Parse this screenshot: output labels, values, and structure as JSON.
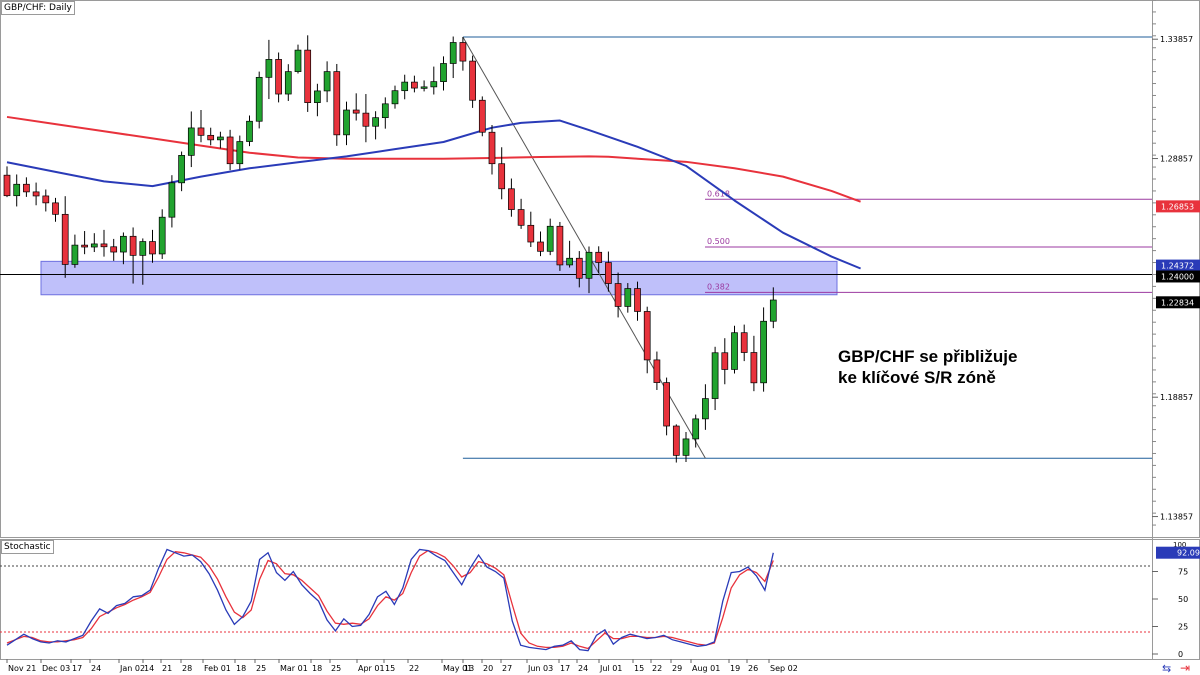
{
  "chart_data": {
    "type": "candlestick",
    "title": "GBP/CHF: Daily",
    "annotation": [
      "GBP/CHF se přibližuje",
      "ke klíčové S/R zóně"
    ],
    "y_ticks": [
      1.33857,
      1.28857,
      1.18857,
      1.13857
    ],
    "ylim": [
      1.13,
      1.355
    ],
    "x_tick_labels": [
      "Nov 21",
      "Dec 03",
      "17",
      "24",
      "Jan 02",
      "14",
      "21",
      "28",
      "Feb 01",
      "18",
      "25",
      "Mar 01",
      "18",
      "25",
      "Apr 01",
      "15",
      "22",
      "May 01",
      "13",
      "20",
      "27",
      "Jun 03",
      "17",
      "24",
      "Jul 01",
      "15",
      "22",
      "29",
      "Aug 01",
      "19",
      "26",
      "Sep 02"
    ],
    "price_badges": [
      {
        "value": "1.26853",
        "color": "#e8323c"
      },
      {
        "value": "1.24372",
        "color": "#2a3bb8"
      },
      {
        "value": "1.24000",
        "color": "#000000"
      },
      {
        "value": "1.22834",
        "color": "#000000"
      }
    ],
    "fib_levels": [
      {
        "label": "0.618",
        "value": 1.2715
      },
      {
        "label": "0.500",
        "value": 1.2515
      },
      {
        "label": "0.382",
        "value": 1.2325
      }
    ],
    "fib_range": {
      "high": 1.3395,
      "low": 1.163
    },
    "sr_zone": [
      1.2315,
      1.2455
    ],
    "horizontal_line": 1.24,
    "series": [
      {
        "name": "",
        "color": "#e8323c",
        "points": [
          [
            0,
            1.306
          ],
          [
            5,
            1.303
          ],
          [
            10,
            1.3
          ],
          [
            15,
            1.297
          ],
          [
            20,
            1.294
          ],
          [
            25,
            1.291
          ],
          [
            30,
            1.289
          ],
          [
            35,
            1.2885
          ],
          [
            40,
            1.2885
          ],
          [
            45,
            1.2885
          ],
          [
            50,
            1.2888
          ],
          [
            55,
            1.2892
          ],
          [
            60,
            1.2895
          ],
          [
            62,
            1.2893
          ],
          [
            65,
            1.2885
          ],
          [
            70,
            1.2872
          ],
          [
            75,
            1.2845
          ],
          [
            80,
            1.281
          ],
          [
            85,
            1.275
          ],
          [
            88,
            1.2705
          ]
        ]
      },
      {
        "name": "",
        "color": "#2a3bb8",
        "points": [
          [
            0,
            1.287
          ],
          [
            5,
            1.283
          ],
          [
            10,
            1.279
          ],
          [
            15,
            1.277
          ],
          [
            20,
            1.281
          ],
          [
            25,
            1.2845
          ],
          [
            30,
            1.287
          ],
          [
            35,
            1.2895
          ],
          [
            40,
            1.2925
          ],
          [
            45,
            1.2955
          ],
          [
            50,
            1.3015
          ],
          [
            53,
            1.3035
          ],
          [
            57,
            1.3045
          ],
          [
            60,
            1.3005
          ],
          [
            65,
            1.2935
          ],
          [
            70,
            1.2855
          ],
          [
            75,
            1.271
          ],
          [
            80,
            1.2575
          ],
          [
            85,
            1.2475
          ],
          [
            88,
            1.2425
          ]
        ]
      }
    ],
    "candles": [
      [
        1.2816,
        1.2853,
        1.2724,
        1.273
      ],
      [
        1.273,
        1.2819,
        1.2685,
        1.2778
      ],
      [
        1.2778,
        1.2807,
        1.2725,
        1.2746
      ],
      [
        1.2746,
        1.2785,
        1.269,
        1.2729
      ],
      [
        1.2729,
        1.2756,
        1.2664,
        1.27
      ],
      [
        1.27,
        1.2721,
        1.2621,
        1.2652
      ],
      [
        1.2652,
        1.2728,
        1.2386,
        1.2442
      ],
      [
        1.2442,
        1.2567,
        1.2428,
        1.2523
      ],
      [
        1.2523,
        1.2582,
        1.2485,
        1.2515
      ],
      [
        1.2515,
        1.2573,
        1.2494,
        1.2528
      ],
      [
        1.2528,
        1.2587,
        1.2475,
        1.2516
      ],
      [
        1.2516,
        1.2549,
        1.2457,
        1.2494
      ],
      [
        1.2494,
        1.2576,
        1.2443,
        1.256
      ],
      [
        1.256,
        1.2597,
        1.2362,
        1.248
      ],
      [
        1.248,
        1.2551,
        1.2357,
        1.2538
      ],
      [
        1.2538,
        1.2587,
        1.2449,
        1.2486
      ],
      [
        1.2486,
        1.2673,
        1.2465,
        1.264
      ],
      [
        1.264,
        1.2816,
        1.2597,
        1.2784
      ],
      [
        1.2784,
        1.2915,
        1.2749,
        1.2899
      ],
      [
        1.2899,
        1.3083,
        1.285,
        1.3014
      ],
      [
        1.3014,
        1.3089,
        1.2954,
        1.2983
      ],
      [
        1.2983,
        1.3015,
        1.2941,
        1.2964
      ],
      [
        1.2964,
        1.2998,
        1.2928,
        1.2976
      ],
      [
        1.2976,
        1.3006,
        1.2837,
        1.2864
      ],
      [
        1.2864,
        1.2982,
        1.284,
        1.2957
      ],
      [
        1.2957,
        1.3066,
        1.2938,
        1.3042
      ],
      [
        1.3042,
        1.325,
        1.3012,
        1.3226
      ],
      [
        1.3226,
        1.3383,
        1.3135,
        1.3301
      ],
      [
        1.3301,
        1.333,
        1.3121,
        1.3156
      ],
      [
        1.3156,
        1.3281,
        1.3127,
        1.325
      ],
      [
        1.325,
        1.3363,
        1.3242,
        1.334
      ],
      [
        1.334,
        1.3402,
        1.3081,
        1.312
      ],
      [
        1.312,
        1.3199,
        1.3063,
        1.3169
      ],
      [
        1.3169,
        1.3293,
        1.3122,
        1.325
      ],
      [
        1.325,
        1.3282,
        1.2939,
        1.2985
      ],
      [
        1.2985,
        1.3124,
        1.2942,
        1.3089
      ],
      [
        1.3089,
        1.3159,
        1.3045,
        1.3076
      ],
      [
        1.3076,
        1.3156,
        1.2954,
        1.3021
      ],
      [
        1.3021,
        1.3084,
        1.2966,
        1.3057
      ],
      [
        1.3057,
        1.3142,
        1.3011,
        1.3115
      ],
      [
        1.3115,
        1.3191,
        1.3095,
        1.317
      ],
      [
        1.317,
        1.3237,
        1.3134,
        1.3206
      ],
      [
        1.3206,
        1.3233,
        1.3163,
        1.3181
      ],
      [
        1.3181,
        1.3213,
        1.3167,
        1.3186
      ],
      [
        1.3186,
        1.3271,
        1.3154,
        1.3208
      ],
      [
        1.3208,
        1.3314,
        1.3171,
        1.3284
      ],
      [
        1.3284,
        1.3397,
        1.3223,
        1.3372
      ],
      [
        1.3372,
        1.3395,
        1.3254,
        1.3294
      ],
      [
        1.3294,
        1.3317,
        1.3098,
        1.313
      ],
      [
        1.313,
        1.3146,
        1.2979,
        1.2996
      ],
      [
        1.2996,
        1.3026,
        1.2819,
        1.2864
      ],
      [
        1.2864,
        1.2933,
        1.2715,
        1.2759
      ],
      [
        1.2759,
        1.2802,
        1.2642,
        1.2672
      ],
      [
        1.2672,
        1.2717,
        1.2591,
        1.2606
      ],
      [
        1.2606,
        1.2663,
        1.2515,
        1.2536
      ],
      [
        1.2536,
        1.258,
        1.2477,
        1.2497
      ],
      [
        1.2497,
        1.2634,
        1.2481,
        1.2602
      ],
      [
        1.2602,
        1.262,
        1.2415,
        1.244
      ],
      [
        1.244,
        1.2541,
        1.2429,
        1.2468
      ],
      [
        1.2468,
        1.2498,
        1.2346,
        1.2384
      ],
      [
        1.2384,
        1.2517,
        1.2322,
        1.2493
      ],
      [
        1.2493,
        1.2518,
        1.2406,
        1.245
      ],
      [
        1.245,
        1.2496,
        1.2328,
        1.2362
      ],
      [
        1.2362,
        1.2408,
        1.222,
        1.2266
      ],
      [
        1.2266,
        1.2364,
        1.224,
        1.2341
      ],
      [
        1.2341,
        1.237,
        1.2206,
        1.2245
      ],
      [
        1.2245,
        1.2265,
        1.1986,
        1.2042
      ],
      [
        1.2042,
        1.2077,
        1.1916,
        1.1947
      ],
      [
        1.1947,
        1.1968,
        1.1726,
        1.1765
      ],
      [
        1.1765,
        1.1772,
        1.1612,
        1.1642
      ],
      [
        1.1642,
        1.174,
        1.1614,
        1.1711
      ],
      [
        1.1711,
        1.1813,
        1.1675,
        1.1795
      ],
      [
        1.1795,
        1.194,
        1.1749,
        1.188
      ],
      [
        1.188,
        1.2097,
        1.1832,
        1.2072
      ],
      [
        1.2072,
        1.2133,
        1.194,
        1.2002
      ],
      [
        1.2002,
        1.2185,
        1.1985,
        1.2156
      ],
      [
        1.2156,
        1.219,
        1.2037,
        1.2073
      ],
      [
        1.2073,
        1.2143,
        1.1911,
        1.1946
      ],
      [
        1.1946,
        1.2262,
        1.1909,
        1.2204
      ],
      [
        1.2204,
        1.2346,
        1.2175,
        1.2293
      ]
    ]
  },
  "stochastic": {
    "title": "Stochastic",
    "ylim": [
      0,
      100
    ],
    "y_ticks": [
      75,
      50,
      25,
      0
    ],
    "top_label": "100",
    "levels": [
      80,
      20
    ],
    "value_badge": "92.09",
    "k_line": {
      "name": "",
      "color": "#2a3bb8",
      "values": [
        8,
        13,
        18,
        14,
        11,
        10,
        12,
        11,
        14,
        17,
        30,
        41,
        37,
        44,
        46,
        52,
        53,
        58,
        78,
        95,
        92,
        89,
        90,
        84,
        73,
        58,
        40,
        27,
        34,
        48,
        86,
        92,
        74,
        67,
        75,
        63,
        55,
        48,
        31,
        21,
        32,
        25,
        26,
        36,
        52,
        57,
        45,
        60,
        86,
        95,
        94,
        89,
        85,
        74,
        63,
        78,
        90,
        79,
        75,
        69,
        30,
        8,
        6,
        5,
        4,
        7,
        8,
        12,
        4,
        3,
        17,
        22,
        9,
        15,
        18,
        16,
        14,
        15,
        17,
        13,
        11,
        9,
        7,
        8,
        11,
        48,
        74,
        75,
        79,
        71,
        58,
        92
      ]
    },
    "d_line": {
      "name": "",
      "color": "#e8323c",
      "values": [
        10,
        13,
        16,
        15,
        12,
        11,
        11,
        12,
        13,
        15,
        23,
        34,
        38,
        42,
        45,
        49,
        52,
        56,
        70,
        86,
        93,
        92,
        90,
        88,
        80,
        68,
        52,
        38,
        33,
        40,
        68,
        85,
        82,
        73,
        72,
        67,
        60,
        53,
        39,
        28,
        27,
        28,
        27,
        32,
        44,
        52,
        49,
        55,
        74,
        89,
        94,
        92,
        88,
        80,
        70,
        74,
        84,
        82,
        78,
        72,
        45,
        19,
        10,
        7,
        6,
        6,
        7,
        10,
        7,
        5,
        12,
        19,
        14,
        14,
        16,
        16,
        15,
        15,
        16,
        15,
        13,
        11,
        9,
        8,
        10,
        33,
        60,
        72,
        77,
        74,
        66,
        85
      ]
    }
  },
  "footer_icons": [
    "link-icon",
    "arrow-icon"
  ]
}
